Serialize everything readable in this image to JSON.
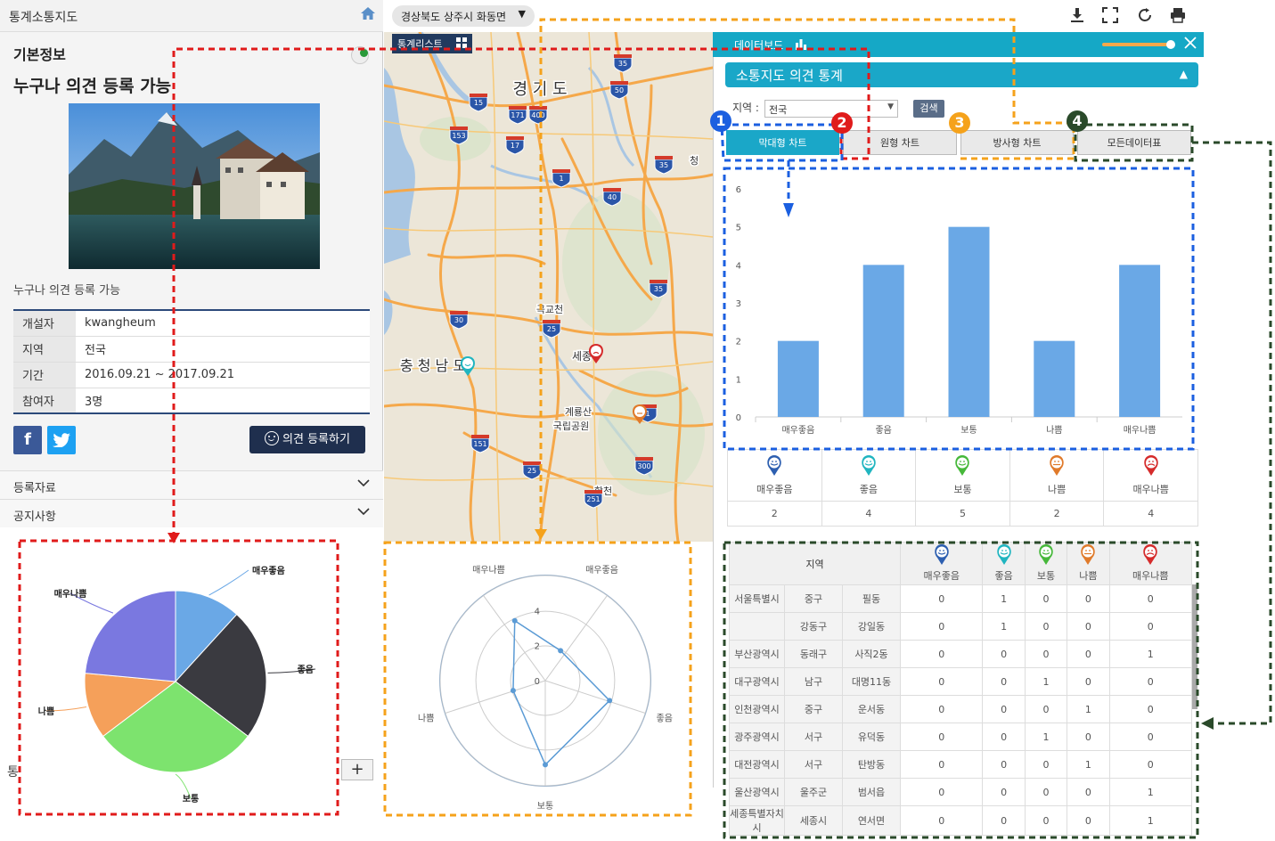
{
  "app": {
    "title": "통계소통지도"
  },
  "info": {
    "section_title": "기본정보",
    "main_title": "누구나 의견 등록 가능",
    "description": "누구나 의견 등록 가능",
    "rows": [
      {
        "k": "개설자",
        "v": "kwangheum"
      },
      {
        "k": "지역",
        "v": "전국"
      },
      {
        "k": "기간",
        "v": "2016.09.21 ~ 2017.09.21"
      },
      {
        "k": "참여자",
        "v": "3명"
      }
    ],
    "facebook": "f",
    "register_label": "의견 등록하기",
    "accordion": [
      "등록자료",
      "공지사항"
    ],
    "stats_label": "통"
  },
  "map": {
    "region_selector": "경상북도 상주시 화동면",
    "list_button": "통계리스트",
    "labels": [
      {
        "t": "경 기 도",
        "s": 18
      },
      {
        "t": "곡교천",
        "s": 11
      },
      {
        "t": "충 청 남 도",
        "s": 16
      },
      {
        "t": "계룡산",
        "s": 11
      },
      {
        "t": "국립공원",
        "s": 11
      },
      {
        "t": "합천",
        "s": 11
      },
      {
        "t": "청",
        "s": 11
      },
      {
        "t": "세종",
        "s": 12
      }
    ],
    "route_numbers": [
      "35",
      "50",
      "15",
      "171",
      "400",
      "153",
      "17",
      "1",
      "35",
      "40",
      "35",
      "30",
      "25",
      "1",
      "151",
      "25",
      "300",
      "251"
    ]
  },
  "dashboard": {
    "title": "데이터보드",
    "opinion_title": "소통지도 의견 통계",
    "filter_label": "지역 :",
    "filter_value": "전국",
    "search_label": "검색",
    "tabs": [
      "막대형 차트",
      "원형 차트",
      "방사형 차트",
      "모든데이터표"
    ],
    "badges": [
      "1",
      "2",
      "3",
      "4"
    ],
    "categories": [
      {
        "label": "매우좋음",
        "count": "2",
        "color": "#2d5fb0"
      },
      {
        "label": "좋음",
        "count": "4",
        "color": "#20b5c0"
      },
      {
        "label": "보통",
        "count": "5",
        "color": "#46b83a"
      },
      {
        "label": "나쁨",
        "count": "2",
        "color": "#e07a2a"
      },
      {
        "label": "매우나쁨",
        "count": "4",
        "color": "#d52b2b"
      }
    ],
    "table_header_region": "지역",
    "table_rows": [
      {
        "sido": "서울특별시",
        "sgg": "중구",
        "dong": "필동",
        "v": [
          "0",
          "1",
          "0",
          "0",
          "0"
        ]
      },
      {
        "sido": "",
        "sgg": "강동구",
        "dong": "강일동",
        "v": [
          "0",
          "1",
          "0",
          "0",
          "0"
        ]
      },
      {
        "sido": "부산광역시",
        "sgg": "동래구",
        "dong": "사직2동",
        "v": [
          "0",
          "0",
          "0",
          "0",
          "1"
        ]
      },
      {
        "sido": "대구광역시",
        "sgg": "남구",
        "dong": "대명11동",
        "v": [
          "0",
          "0",
          "1",
          "0",
          "0"
        ]
      },
      {
        "sido": "인천광역시",
        "sgg": "중구",
        "dong": "운서동",
        "v": [
          "0",
          "0",
          "0",
          "1",
          "0"
        ]
      },
      {
        "sido": "광주광역시",
        "sgg": "서구",
        "dong": "유덕동",
        "v": [
          "0",
          "0",
          "1",
          "0",
          "0"
        ]
      },
      {
        "sido": "대전광역시",
        "sgg": "서구",
        "dong": "탄방동",
        "v": [
          "0",
          "0",
          "0",
          "1",
          "0"
        ]
      },
      {
        "sido": "울산광역시",
        "sgg": "울주군",
        "dong": "범서읍",
        "v": [
          "0",
          "0",
          "0",
          "0",
          "1"
        ]
      },
      {
        "sido": "세종특별자치시",
        "sgg": "세종시",
        "dong": "연서면",
        "v": [
          "0",
          "0",
          "0",
          "0",
          "1"
        ]
      }
    ]
  },
  "chart_data": [
    {
      "type": "bar",
      "categories": [
        "매우좋음",
        "좋음",
        "보통",
        "나쁨",
        "매우나쁨"
      ],
      "values": [
        2,
        4,
        5,
        2,
        4
      ],
      "ylim": [
        0,
        6
      ],
      "yticks": [
        "0",
        "1",
        "2",
        "3",
        "4",
        "5",
        "6"
      ],
      "color": "#6aa8e6",
      "grid": false
    },
    {
      "type": "pie",
      "categories": [
        "매우좋음",
        "좋음",
        "보통",
        "나쁨",
        "매우나쁨"
      ],
      "values": [
        2,
        4,
        5,
        2,
        4
      ],
      "colors": [
        "#6aa8e6",
        "#3a3a40",
        "#7de36e",
        "#f5a05a",
        "#7a78e0"
      ]
    },
    {
      "type": "radar",
      "categories": [
        "매우좋음",
        "좋음",
        "보통",
        "나쁨",
        "매우나쁨"
      ],
      "values": [
        2,
        4,
        5,
        2,
        4
      ],
      "rlim": [
        0,
        6
      ],
      "rticks": [
        "0",
        "2",
        "4"
      ],
      "color": "#5b9bd5"
    }
  ]
}
